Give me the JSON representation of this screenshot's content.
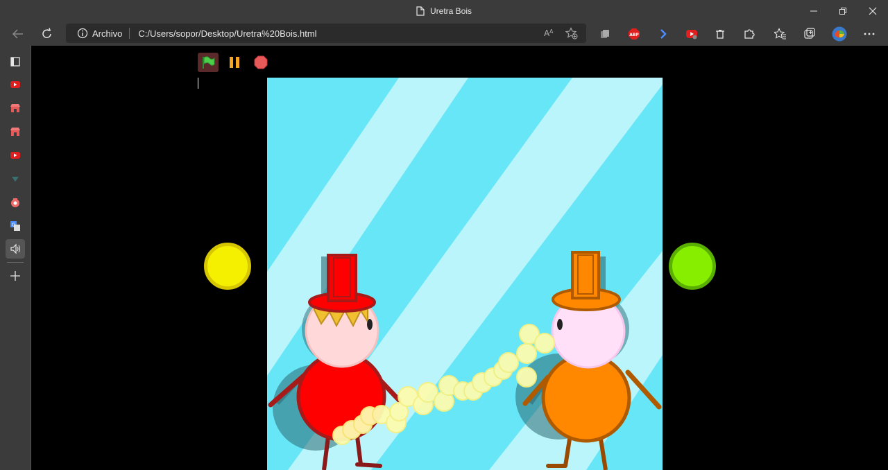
{
  "window": {
    "title": "Uretra Bois"
  },
  "address": {
    "scheme_label": "Archivo",
    "url": "C:/Users/sopor/Desktop/Uretra%20Bois.html"
  },
  "toolbar": {
    "reader_icon_label": "A",
    "abp_label": "ABP"
  },
  "game": {
    "left_button_color": "#f5f000",
    "right_button_color": "#88ee00",
    "background_color": "#66e6f7",
    "stripe_color": "#b9f5fb",
    "player_left": {
      "color": "#ff0000",
      "hat_color": "#ff0000"
    },
    "player_right": {
      "color": "#ff8800",
      "hat_color": "#ff8800"
    }
  }
}
